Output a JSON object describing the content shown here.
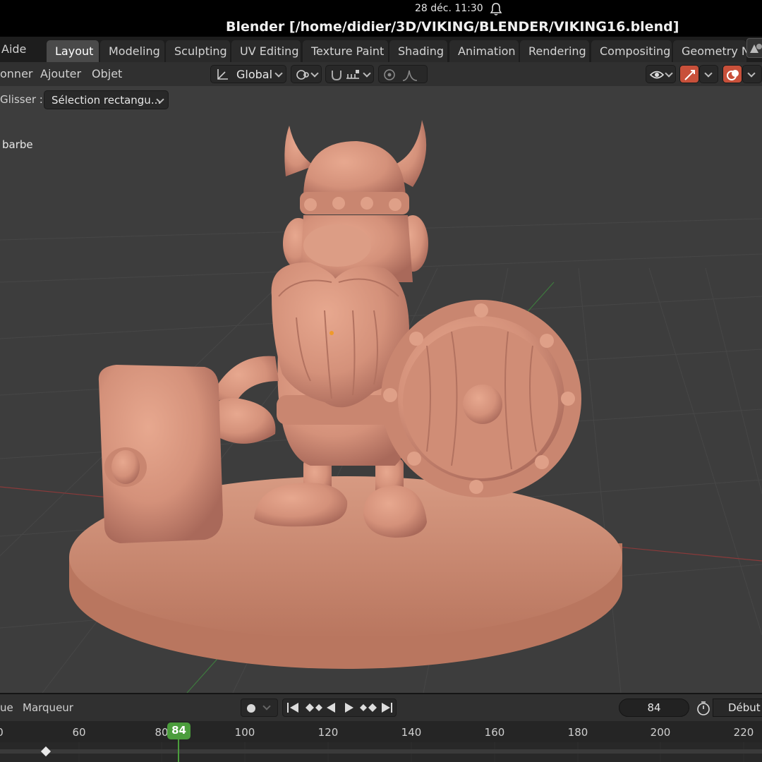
{
  "system": {
    "datetime": "28 déc.  11:30"
  },
  "window": {
    "title": "Blender [/home/didier/3D/VIKING/BLENDER/VIKING16.blend]"
  },
  "topbar": {
    "menu_aide": "Aide",
    "tabs": [
      "Layout",
      "Modeling",
      "Sculpting",
      "UV Editing",
      "Texture Paint",
      "Shading",
      "Animation",
      "Rendering",
      "Compositing",
      "Geometry N"
    ],
    "active_tab": "Layout"
  },
  "header": {
    "menus": [
      "onner",
      "Ajouter",
      "Objet"
    ],
    "orientation": "Global"
  },
  "toolsettings": {
    "drag_label": "Glisser :",
    "drag_value": "Sélection rectangu..."
  },
  "viewport": {
    "active_object": "barbe",
    "model_color": "#d4917a",
    "background_color": "#3d3d3d"
  },
  "timeline": {
    "menus": [
      "ue",
      "Marqueur"
    ],
    "current_frame": "84",
    "start_label": "Début",
    "ruler_ticks": [
      "0",
      "60",
      "80",
      "100",
      "120",
      "140",
      "160",
      "180",
      "200",
      "220"
    ],
    "playhead_label": "84",
    "accent_color": "#4b9d3c"
  }
}
